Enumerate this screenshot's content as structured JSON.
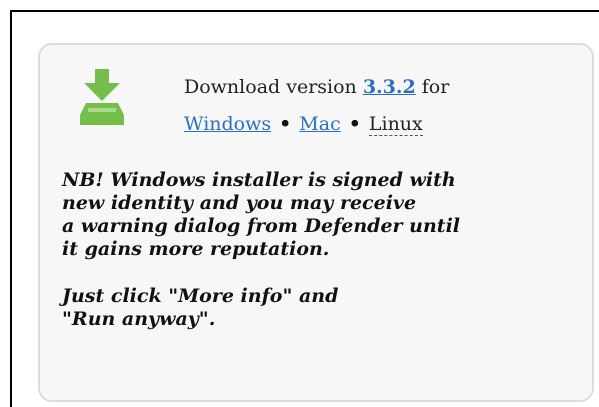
{
  "download": {
    "prefix": "Download version",
    "version": "3.3.2",
    "suffix": "for",
    "platforms": {
      "windows": "Windows",
      "mac": "Mac",
      "linux": "Linux"
    },
    "separator": "•",
    "icon": "download-icon"
  },
  "notice": {
    "lines": [
      "NB! Windows installer is signed with",
      "new identity and you may receive",
      "a warning dialog from Defender until",
      "it gains more reputation."
    ],
    "instruction_lines": [
      "Just click \"More info\" and",
      "\"Run anyway\"."
    ]
  },
  "colors": {
    "icon_green": "#74bf4a",
    "link": "#2a6fc4",
    "card_bg": "#f7f7f7",
    "card_border": "#dcdcdc"
  }
}
